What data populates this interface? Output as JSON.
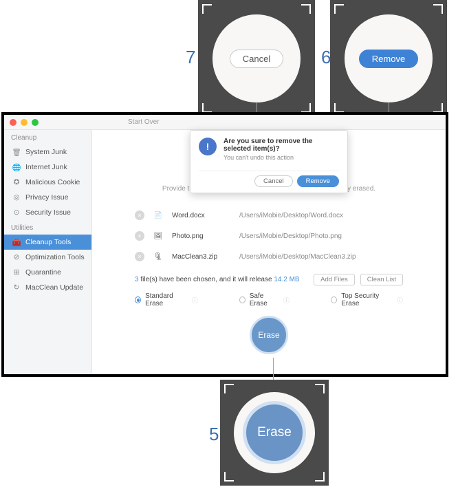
{
  "callouts": {
    "c7": {
      "num": "7",
      "label": "Cancel"
    },
    "c6": {
      "num": "6",
      "label": "Remove"
    },
    "c5": {
      "num": "5",
      "label": "Erase"
    }
  },
  "titlebar": {
    "start_over": "Start Over"
  },
  "sidebar": {
    "hdr1": "Cleanup",
    "items1": [
      {
        "label": "System Junk",
        "icon": "trash-icon"
      },
      {
        "label": "Internet Junk",
        "icon": "globe-icon"
      },
      {
        "label": "Malicious Cookie",
        "icon": "bug-icon"
      },
      {
        "label": "Privacy Issue",
        "icon": "lock-icon"
      },
      {
        "label": "Security Issue",
        "icon": "shield-icon"
      }
    ],
    "hdr2": "Utilities",
    "items2": [
      {
        "label": "Cleanup Tools",
        "icon": "briefcase-icon"
      },
      {
        "label": "Optimization Tools",
        "icon": "gauge-icon"
      },
      {
        "label": "Quarantine",
        "icon": "box-icon"
      },
      {
        "label": "MacClean Update",
        "icon": "refresh-icon"
      }
    ]
  },
  "main": {
    "subtitle": "Provide three standards to ensure your files could be securely erased.",
    "files": [
      {
        "name": "Word.docx",
        "path": "/Users/iMobie/Desktop/Word.docx"
      },
      {
        "name": "Photo.png",
        "path": "/Users/iMobie/Desktop/Photo.png"
      },
      {
        "name": "MacClean3.zip",
        "path": "/Users/iMobie/Desktop/MacClean3.zip"
      }
    ],
    "summary_count": "3",
    "summary_mid": " file(s) have been chosen, and it will release ",
    "summary_size": "14.2 MB",
    "add_files": "Add Files",
    "clean_list": "Clean List",
    "modes": {
      "standard": "Standard Erase",
      "safe": "Safe Erase",
      "top": "Top Security Erase"
    },
    "erase": "Erase"
  },
  "dialog": {
    "title": "Are you sure to remove the selected item(s)?",
    "sub": "You can't undo this action",
    "cancel": "Cancel",
    "remove": "Remove"
  }
}
